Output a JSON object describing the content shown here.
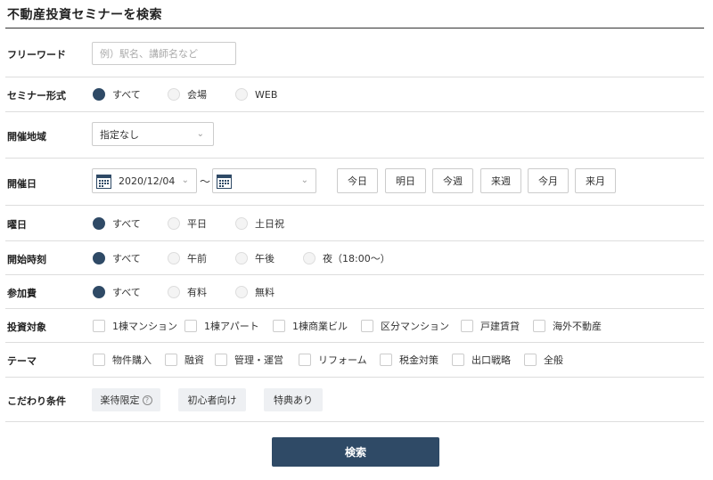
{
  "title": "不動産投資セミナーを検索",
  "free_word": {
    "label": "フリーワード",
    "placeholder": "例）駅名、講師名など"
  },
  "format": {
    "label": "セミナー形式",
    "options": [
      "すべて",
      "会場",
      "WEB"
    ],
    "selected": 0
  },
  "area": {
    "label": "開催地域",
    "value": "指定なし"
  },
  "date": {
    "label": "開催日",
    "start": "2020/12/04",
    "end": "",
    "separator": "～",
    "quick": [
      "今日",
      "明日",
      "今週",
      "来週",
      "今月",
      "来月"
    ]
  },
  "weekday": {
    "label": "曜日",
    "options": [
      "すべて",
      "平日",
      "土日祝"
    ],
    "selected": 0
  },
  "time": {
    "label": "開始時刻",
    "options": [
      "すべて",
      "午前",
      "午後",
      "夜（18:00～）"
    ],
    "selected": 0
  },
  "fee": {
    "label": "参加費",
    "options": [
      "すべて",
      "有料",
      "無料"
    ],
    "selected": 0
  },
  "target": {
    "label": "投資対象",
    "options": [
      "1棟マンション",
      "1棟アパート",
      "1棟商業ビル",
      "区分マンション",
      "戸建賃貸",
      "海外不動産"
    ]
  },
  "theme": {
    "label": "テーマ",
    "options": [
      "物件購入",
      "融資",
      "管理・運営",
      "リフォーム",
      "税金対策",
      "出口戦略",
      "全般"
    ]
  },
  "conditions": {
    "label": "こだわり条件",
    "chips": [
      "楽待限定",
      "初心者向け",
      "特典あり"
    ]
  },
  "search_label": "検索",
  "colors": {
    "accent": "#2f4a66",
    "chip_bg": "#eef0f3",
    "border": "#dddddd"
  },
  "icons": {
    "calendar": "calendar-icon",
    "chevron": "chevron-down-icon",
    "help": "help-icon"
  }
}
